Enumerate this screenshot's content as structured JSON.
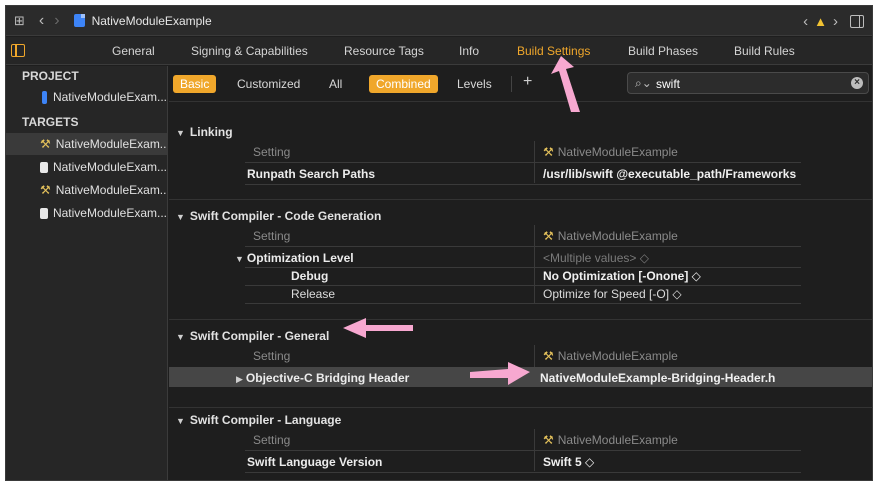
{
  "titlebar": {
    "project_name": "NativeModuleExample"
  },
  "tabs": [
    "General",
    "Signing & Capabilities",
    "Resource Tags",
    "Info",
    "Build Settings",
    "Build Phases",
    "Build Rules"
  ],
  "active_tab": "Build Settings",
  "sidebar": {
    "project_header": "PROJECT",
    "project_item": "NativeModuleExam...",
    "targets_header": "TARGETS",
    "targets": [
      {
        "label": "NativeModuleExam...",
        "icon": "app-target-icon",
        "selected": true
      },
      {
        "label": "NativeModuleExam...",
        "icon": "framework-target-icon",
        "selected": false
      },
      {
        "label": "NativeModuleExam...",
        "icon": "app-target-icon",
        "selected": false
      },
      {
        "label": "NativeModuleExam...",
        "icon": "framework-target-icon",
        "selected": false
      }
    ]
  },
  "filter": {
    "basic": "Basic",
    "customized": "Customized",
    "all": "All",
    "combined": "Combined",
    "levels": "Levels",
    "add": "+",
    "search_value": "swift"
  },
  "sections": {
    "linking": {
      "title": "Linking",
      "header_setting": "Setting",
      "header_target": "NativeModuleExample",
      "rows": [
        {
          "name": "Runpath Search Paths",
          "value": "/usr/lib/swift  @executable_path/Frameworks"
        }
      ]
    },
    "codegen": {
      "title": "Swift Compiler - Code Generation",
      "header_setting": "Setting",
      "header_target": "NativeModuleExample",
      "opt_name": "Optimization Level",
      "opt_value": "<Multiple values> ◇",
      "debug_name": "Debug",
      "debug_value": "No Optimization [-Onone] ◇",
      "release_name": "Release",
      "release_value": "Optimize for Speed [-O] ◇"
    },
    "general": {
      "title": "Swift Compiler - General",
      "header_setting": "Setting",
      "header_target": "NativeModuleExample",
      "rows": [
        {
          "name": "Objective-C Bridging Header",
          "value": "NativeModuleExample-Bridging-Header.h"
        }
      ]
    },
    "language": {
      "title": "Swift Compiler - Language",
      "header_setting": "Setting",
      "header_target": "NativeModuleExample",
      "rows": [
        {
          "name": "Swift Language Version",
          "value": "Swift 5 ◇"
        }
      ]
    }
  },
  "colors": {
    "accent": "#f0a72b",
    "annotation_arrow": "#f7a8d0"
  }
}
